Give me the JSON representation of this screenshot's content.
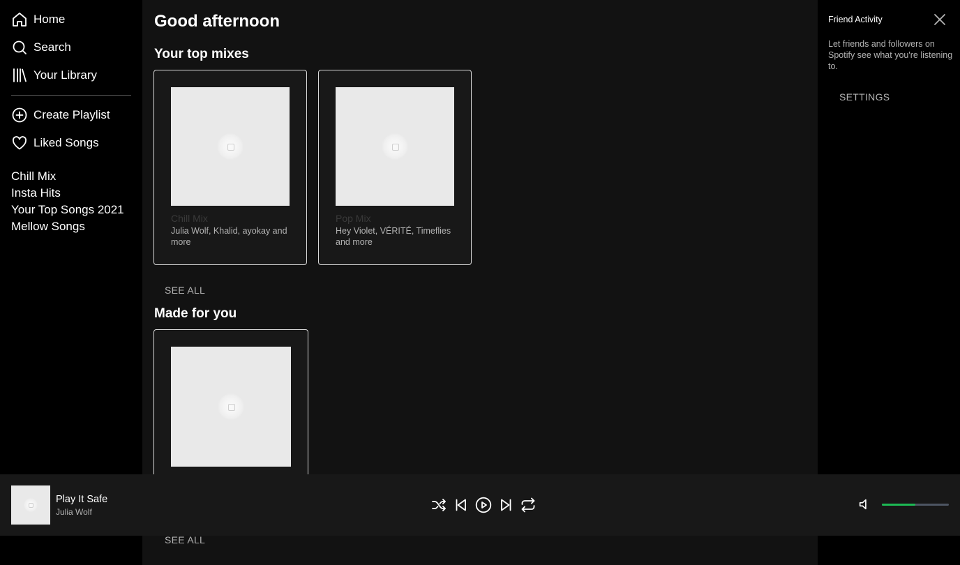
{
  "sidebar": {
    "nav": [
      {
        "label": "Home",
        "icon": "home-icon"
      },
      {
        "label": "Search",
        "icon": "search-icon"
      },
      {
        "label": "Your Library",
        "icon": "library-icon"
      }
    ],
    "actions": [
      {
        "label": "Create Playlist",
        "icon": "plus-circle-icon"
      },
      {
        "label": "Liked Songs",
        "icon": "heart-icon"
      }
    ],
    "playlists": [
      "Chill Mix",
      "Insta Hits",
      "Your Top Songs 2021",
      "Mellow Songs"
    ]
  },
  "main": {
    "greeting": "Good afternoon",
    "top_mixes": {
      "title": "Your top mixes",
      "cards": [
        {
          "title": "Chill Mix",
          "subtitle": "Julia Wolf, Khalid, ayokay and more"
        },
        {
          "title": "Pop Mix",
          "subtitle": "Hey Violet, VÉRITÉ, Timeflies and more"
        }
      ],
      "see_all": "SEE ALL"
    },
    "made_for_you": {
      "title": "Made for you",
      "see_all": "SEE ALL"
    }
  },
  "friends": {
    "title": "Friend Activity",
    "message": "Let friends and followers on Spotify see what you're listening to.",
    "settings": "SETTINGS",
    "close_icon": "close-icon"
  },
  "player": {
    "track_title": "Play It Safe",
    "artist": "Julia Wolf",
    "volume_level": 0.5,
    "colors": {
      "volume_fill": "#1db954",
      "volume_track": "#4d5562"
    }
  },
  "colors": {
    "background_main": "#121212",
    "background_side": "#000000",
    "player_bar": "#181818",
    "accent": "#1db954"
  }
}
